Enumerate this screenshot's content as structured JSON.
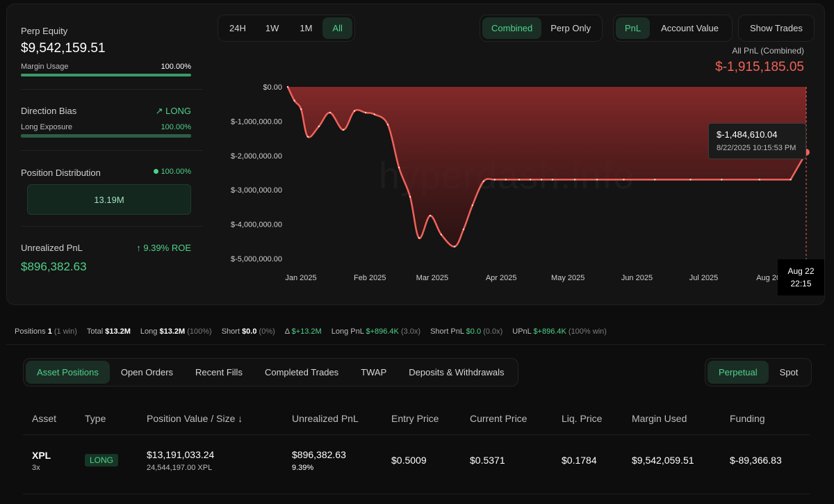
{
  "summary": {
    "perp_equity_label": "Perp Equity",
    "perp_equity": "$9,542,159.51",
    "margin_usage_label": "Margin Usage",
    "margin_usage": "100.00%",
    "direction_bias_label": "Direction Bias",
    "direction_bias": "LONG",
    "long_exposure_label": "Long Exposure",
    "long_exposure": "100.00%",
    "position_distribution_label": "Position Distribution",
    "position_distribution_pct": "100.00%",
    "position_distribution_value": "13.19M",
    "unrealized_pnl_label": "Unrealized PnL",
    "roe": "9.39% ROE",
    "unrealized_pnl": "$896,382.63"
  },
  "timeframes": [
    "24H",
    "1W",
    "1M",
    "All"
  ],
  "active_timeframe": "All",
  "mode_toggle": [
    "Combined",
    "Perp Only"
  ],
  "active_mode": "Combined",
  "metric_toggle": [
    "PnL",
    "Account Value"
  ],
  "active_metric": "PnL",
  "show_trades_label": "Show Trades",
  "chart_header": {
    "title": "All PnL (Combined)",
    "total": "$-1,915,185.05"
  },
  "tooltip": {
    "value": "$-1,484,610.04",
    "time": "8/22/2025 10:15:53 PM"
  },
  "cursor_label": {
    "date": "Aug 22",
    "time": "22:15"
  },
  "watermark": "hyperdash.info",
  "chart_data": {
    "type": "area",
    "title": "All PnL (Combined)",
    "yticks": [
      "$0.00",
      "$-1,000,000.00",
      "$-2,000,000.00",
      "$-3,000,000.00",
      "$-4,000,000.00",
      "$-5,000,000.00"
    ],
    "ytick_values": [
      0,
      -1000000,
      -2000000,
      -3000000,
      -4000000,
      -5000000
    ],
    "ylim": [
      -5000000,
      0
    ],
    "xticks": [
      "Jan 2025",
      "Feb 2025",
      "Mar 2025",
      "Apr 2025",
      "May 2025",
      "Jun 2025",
      "Jul 2025",
      "Aug 2025"
    ],
    "series": [
      {
        "x": [
          "2025-01-01",
          "2025-01-04",
          "2025-01-07",
          "2025-01-10",
          "2025-01-15",
          "2025-01-20",
          "2025-01-26",
          "2025-01-31",
          "2025-02-05",
          "2025-02-09",
          "2025-02-15",
          "2025-02-20",
          "2025-02-25",
          "2025-03-01",
          "2025-03-06",
          "2025-03-11",
          "2025-03-17",
          "2025-03-21",
          "2025-03-25",
          "2025-03-30",
          "2025-04-04",
          "2025-04-09",
          "2025-04-15",
          "2025-04-20",
          "2025-04-25",
          "2025-04-30",
          "2025-05-10",
          "2025-05-20",
          "2025-06-01",
          "2025-06-15",
          "2025-07-01",
          "2025-07-15",
          "2025-08-01",
          "2025-08-15",
          "2025-08-22"
        ],
        "y": [
          0,
          -400000,
          -650000,
          -1450000,
          -1150000,
          -750000,
          -1250000,
          -700000,
          -750000,
          -800000,
          -1100000,
          -2350000,
          -3200000,
          -4400000,
          -3750000,
          -4300000,
          -4650000,
          -4150000,
          -3450000,
          -2750000,
          -2700000,
          -2700000,
          -2700000,
          -2700000,
          -2700000,
          -2700000,
          -2700000,
          -2700000,
          -2700000,
          -2700000,
          -2700000,
          -2700000,
          -2700000,
          -2700000,
          -1915185
        ]
      }
    ],
    "grid": false,
    "color": "#f0625a"
  },
  "stats_bar": {
    "positions_label": "Positions",
    "positions": "1",
    "positions_note": "(1 win)",
    "total_label": "Total",
    "total": "$13.2M",
    "long_label": "Long",
    "long": "$13.2M",
    "long_note": "(100%)",
    "short_label": "Short",
    "short": "$0.0",
    "short_note": "(0%)",
    "delta_label": "Δ",
    "delta": "$+13.2M",
    "long_pnl_label": "Long PnL",
    "long_pnl": "$+896.4K",
    "long_pnl_note": "(3.0x)",
    "short_pnl_label": "Short PnL",
    "short_pnl": "$0.0",
    "short_pnl_note": "(0.0x)",
    "upnl_label": "UPnL",
    "upnl": "$+896.4K",
    "upnl_note": "(100% win)"
  },
  "tabs": [
    "Asset Positions",
    "Open Orders",
    "Recent Fills",
    "Completed Trades",
    "TWAP",
    "Deposits & Withdrawals"
  ],
  "active_tab": "Asset Positions",
  "market_toggle": [
    "Perpetual",
    "Spot"
  ],
  "active_market": "Perpetual",
  "table": {
    "headers": [
      "Asset",
      "Type",
      "Position Value / Size",
      "Unrealized PnL",
      "Entry Price",
      "Current Price",
      "Liq. Price",
      "Margin Used",
      "Funding"
    ],
    "sort_arrow": "↓",
    "rows": [
      {
        "asset": "XPL",
        "leverage": "3x",
        "type": "LONG",
        "position_value": "$13,191,033.24",
        "position_size": "24,544,197.00 XPL",
        "upnl": "$896,382.63",
        "upnl_pct": "9.39%",
        "entry": "$0.5009",
        "current": "$0.5371",
        "liq": "$0.1784",
        "margin": "$9,542,059.51",
        "funding": "$-89,366.83"
      }
    ]
  }
}
